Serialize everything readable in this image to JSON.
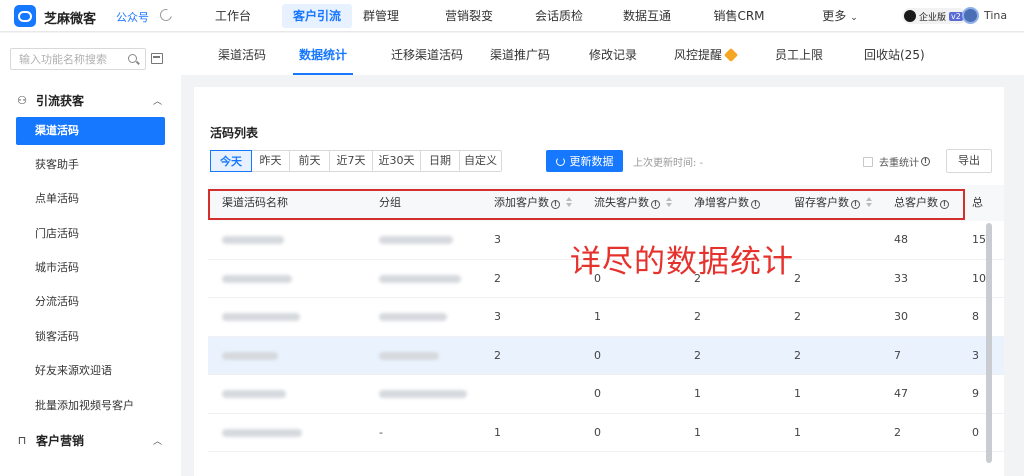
{
  "app": {
    "name": "芝麻微客",
    "channel_link": "公众号"
  },
  "nav": {
    "items": [
      "工作台",
      "客户引流",
      "群管理",
      "营销裂变",
      "会话质检",
      "数据互通",
      "销售CRM",
      "更多"
    ],
    "active": "客户引流",
    "enterprise_badge": "企业版",
    "version_badge": "v2",
    "user_name": "Tina"
  },
  "sidebar": {
    "search_placeholder": "输入功能名称搜索",
    "group1": {
      "label": "引流获客",
      "icon": "user-add-icon"
    },
    "items": [
      "渠道活码",
      "获客助手",
      "点单活码",
      "门店活码",
      "城市活码",
      "分流活码",
      "锁客活码",
      "好友来源欢迎语",
      "批量添加视频号客户"
    ],
    "active_item": "渠道活码",
    "group2": {
      "label": "客户营销",
      "icon": "bookmark-icon"
    }
  },
  "tabs": {
    "items": [
      "渠道活码",
      "数据统计",
      "迁移渠道活码",
      "渠道推广码",
      "修改记录",
      "风控提醒",
      "员工上限",
      "回收站(25)"
    ],
    "active": "数据统计"
  },
  "panel": {
    "section_title": "活码列表",
    "ranges": [
      "今天",
      "昨天",
      "前天",
      "近7天",
      "近30天",
      "日期",
      "自定义"
    ],
    "active_range": "今天",
    "update_button": "更新数据",
    "last_update_label": "上次更新时间: -",
    "dedupe_label": "去重统计",
    "export_button": "导出"
  },
  "table": {
    "columns": [
      "渠道活码名称",
      "分组",
      "添加客户数",
      "流失客户数",
      "净增客户数",
      "留存客户数",
      "总客户数",
      "总"
    ],
    "rows": [
      {
        "name_blur": true,
        "group": "",
        "group_blur": true,
        "add": "3",
        "lost": "",
        "net": "",
        "retain": "",
        "total": "48",
        "extra": "15",
        "highlight": false
      },
      {
        "name_blur": true,
        "group": "",
        "group_blur": true,
        "add": "2",
        "lost": "0",
        "net": "2",
        "retain": "2",
        "total": "33",
        "extra": "10",
        "highlight": false
      },
      {
        "name_blur": true,
        "group": "",
        "group_blur": true,
        "add": "3",
        "lost": "1",
        "net": "2",
        "retain": "2",
        "total": "30",
        "extra": "8",
        "highlight": false
      },
      {
        "name_blur": true,
        "group": "",
        "group_blur": true,
        "add": "2",
        "lost": "0",
        "net": "2",
        "retain": "2",
        "total": "7",
        "extra": "3",
        "highlight": true
      },
      {
        "name_blur": true,
        "group": "",
        "group_blur": true,
        "add": "",
        "lost": "0",
        "net": "1",
        "retain": "1",
        "total": "47",
        "extra": "9",
        "highlight": false
      },
      {
        "name_blur": true,
        "group": "-",
        "group_blur": false,
        "add": "1",
        "lost": "0",
        "net": "1",
        "retain": "1",
        "total": "2",
        "extra": "0",
        "highlight": false
      }
    ]
  },
  "annotation": {
    "callout_text": "详尽的数据统计"
  },
  "colors": {
    "accent": "#1677ff",
    "callout": "#e5322d"
  }
}
